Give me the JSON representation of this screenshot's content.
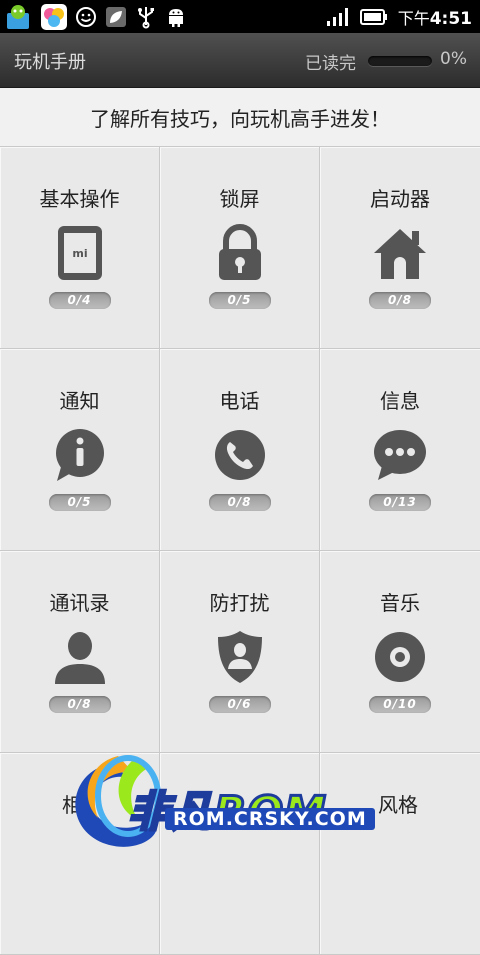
{
  "status_bar": {
    "icons": [
      "app-store-icon",
      "game-center-icon",
      "smiley-icon",
      "leaf-icon",
      "usb-icon",
      "android-icon",
      "signal-icon",
      "battery-icon"
    ],
    "time_prefix": "下午",
    "time": "4:51"
  },
  "header": {
    "title": "玩机手册",
    "progress_label": "已读完",
    "progress_percent": "0%",
    "progress_value": 0
  },
  "tagline": "了解所有技巧，向玩机高手进发！",
  "categories": [
    {
      "label": "基本操作",
      "icon": "phone-icon",
      "count": "0/4"
    },
    {
      "label": "锁屏",
      "icon": "lock-icon",
      "count": "0/5"
    },
    {
      "label": "启动器",
      "icon": "home-icon",
      "count": "0/8"
    },
    {
      "label": "通知",
      "icon": "info-icon",
      "count": "0/5"
    },
    {
      "label": "电话",
      "icon": "phone-handset-icon",
      "count": "0/8"
    },
    {
      "label": "信息",
      "icon": "message-icon",
      "count": "0/13"
    },
    {
      "label": "通讯录",
      "icon": "contact-icon",
      "count": "0/8"
    },
    {
      "label": "防打扰",
      "icon": "shield-user-icon",
      "count": "0/6"
    },
    {
      "label": "音乐",
      "icon": "disc-icon",
      "count": "0/10"
    },
    {
      "label": "相",
      "icon": "",
      "count": ""
    },
    {
      "label": "",
      "icon": "",
      "count": ""
    },
    {
      "label": "风格",
      "icon": "",
      "count": ""
    }
  ],
  "watermark": {
    "brand": "非凡",
    "brand_rom": "ROM",
    "url": "ROM.CRSKY.COM"
  },
  "colors": {
    "accent": "#6cc1ff",
    "icon_gray": "#555555",
    "watermark_blue": "#1f49b6",
    "watermark_green": "#9be81c"
  }
}
